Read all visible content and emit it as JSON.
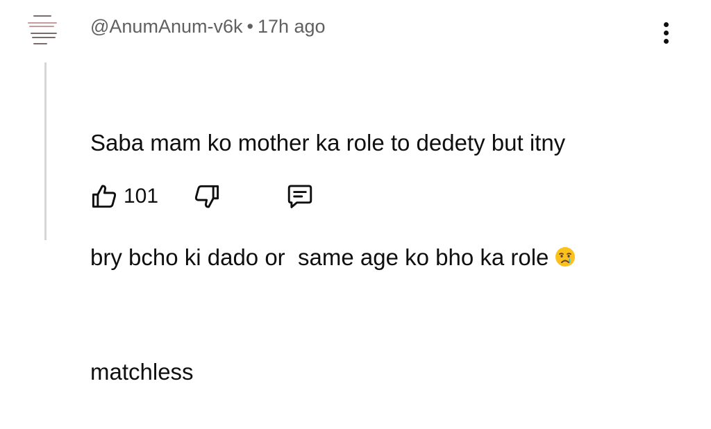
{
  "comment": {
    "author": "@AnumAnum-v6k",
    "separator": "•",
    "timestamp": "17h ago",
    "text_lines": [
      "Saba mam ko mother ka role to dedety but itny",
      "bry bcho ki dado or  same age ko bho ka role",
      "matchless"
    ],
    "emoji": "crying-face"
  },
  "actions": {
    "like_count": "101",
    "like_icon": "thumbs-up-icon",
    "dislike_icon": "thumbs-down-icon",
    "reply_icon": "comment-icon"
  },
  "menu": {
    "icon": "more-vertical-icon"
  },
  "colors": {
    "text": "#0f0f0f",
    "meta": "#606060",
    "thread_line": "#d6d6d6"
  }
}
